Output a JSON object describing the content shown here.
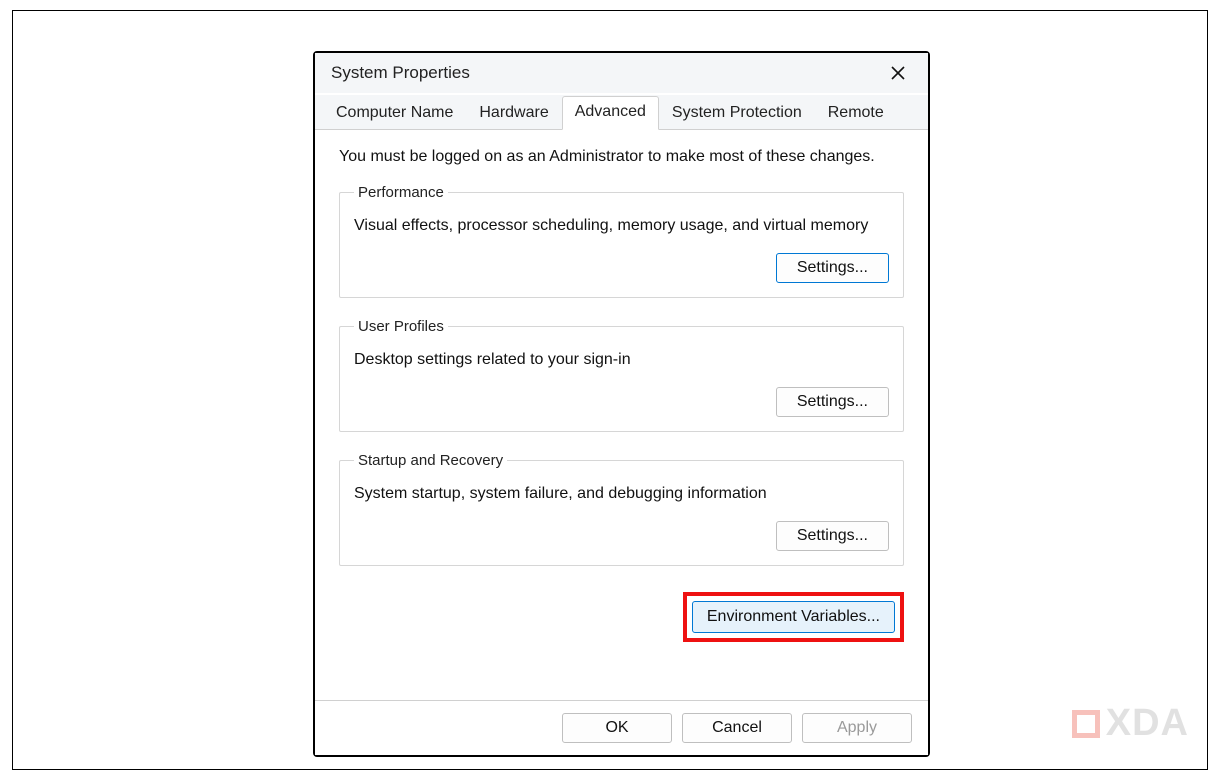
{
  "dialog": {
    "title": "System Properties",
    "close_tooltip": "Close"
  },
  "tabs": [
    {
      "label": "Computer Name"
    },
    {
      "label": "Hardware"
    },
    {
      "label": "Advanced"
    },
    {
      "label": "System Protection"
    },
    {
      "label": "Remote"
    }
  ],
  "active_tab_index": 2,
  "advanced": {
    "admin_note": "You must be logged on as an Administrator to make most of these changes.",
    "sections": {
      "performance": {
        "title": "Performance",
        "desc": "Visual effects, processor scheduling, memory usage, and virtual memory",
        "button": "Settings..."
      },
      "user_profiles": {
        "title": "User Profiles",
        "desc": "Desktop settings related to your sign-in",
        "button": "Settings..."
      },
      "startup_recovery": {
        "title": "Startup and Recovery",
        "desc": "System startup, system failure, and debugging information",
        "button": "Settings..."
      }
    },
    "env_button": "Environment Variables..."
  },
  "footer": {
    "ok": "OK",
    "cancel": "Cancel",
    "apply": "Apply"
  },
  "watermark": "XDA"
}
